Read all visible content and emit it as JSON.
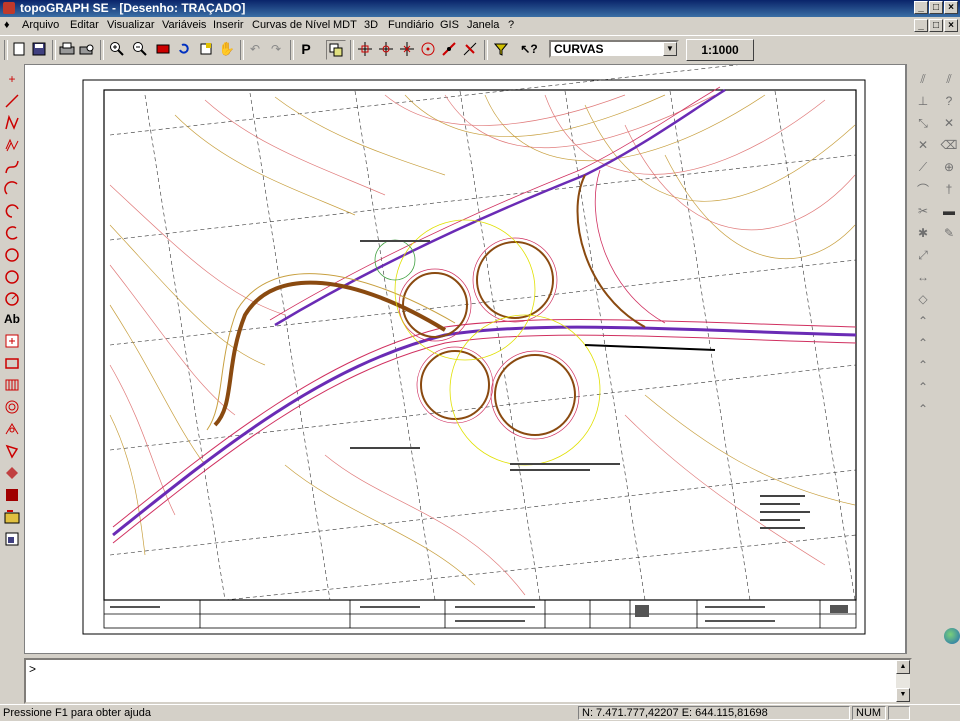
{
  "window": {
    "title": "topoGRAPH SE - [Desenho: TRAÇADO]",
    "controls": [
      "_",
      "□",
      "×"
    ]
  },
  "menubar": {
    "items": [
      "Arquivo",
      "Editar",
      "Visualizar",
      "Variáveis",
      "Inserir",
      "Curvas de Nível",
      "MDT",
      "3D",
      "Fundiário",
      "GIS",
      "Janela",
      "?"
    ],
    "doc_controls": [
      "_",
      "□",
      "×"
    ]
  },
  "toolbar": {
    "layer_select": "CURVAS",
    "scale_label": "1:1000",
    "buttons": [
      "new-icon",
      "save-icon",
      "print-icon",
      "print-preview-icon",
      "zoom-in-icon",
      "zoom-out-icon",
      "zoom-window-icon",
      "refresh-icon",
      "zoom-extents-icon",
      "pan-icon",
      "undo-icon",
      "redo-icon",
      "properties-icon",
      "layers-icon",
      "snap-endpoint-icon",
      "snap-midpoint-icon",
      "snap-intersection-icon",
      "snap-center-icon",
      "snap-perpendicular-icon",
      "snap-nearest-icon",
      "filter-icon",
      "help-pointer-icon"
    ]
  },
  "drawing": {
    "road_color": "#6a2bb5",
    "contour_color_1": "#e07a7a",
    "contour_color_2": "#c8a040",
    "ramp_color": "#8a4a10"
  },
  "command": {
    "prompt": ">"
  },
  "statusbar": {
    "help": "Pressione F1 para obter ajuda",
    "coords": "N: 7.471.777,42207 E: 644.115,81698",
    "mode": "NUM"
  },
  "left_tools": {
    "text_tool": "Ab"
  }
}
